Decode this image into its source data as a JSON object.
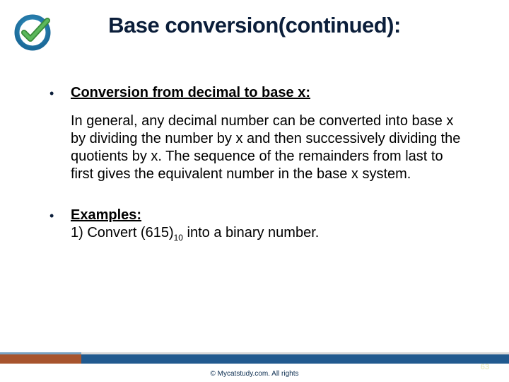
{
  "title": "Base conversion(continued):",
  "bullets": [
    {
      "head": "Conversion from decimal to base x:",
      "body": "In general, any decimal number can be converted into base x by dividing the number by x and then successively dividing the quotients by x. The sequence of the remainders from last to first gives the equivalent number in the base x system."
    },
    {
      "head": "Examples:",
      "example_prefix": "1) Convert (615)",
      "example_sub": "10",
      "example_suffix": " into a binary number."
    }
  ],
  "footer": {
    "copyright": "© Mycatstudy.com. All rights",
    "page": "63"
  }
}
